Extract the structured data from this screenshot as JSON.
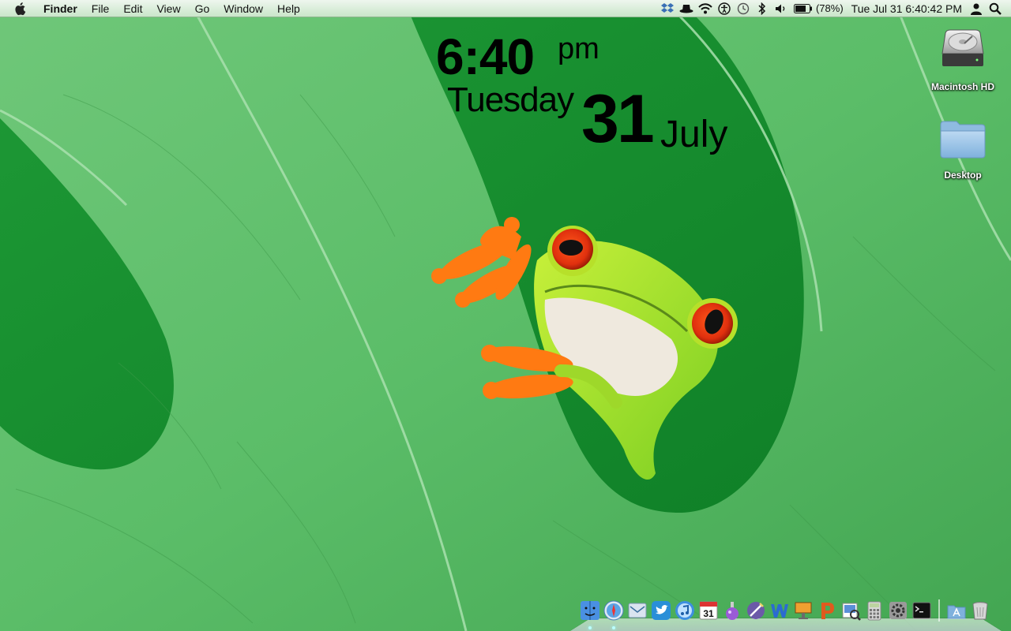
{
  "menubar": {
    "app_name": "Finder",
    "menus": [
      "File",
      "Edit",
      "View",
      "Go",
      "Window",
      "Help"
    ],
    "battery_percent": "(78%)",
    "datetime": "Tue Jul 31  6:40:42 PM",
    "status_icons": [
      "dropbox-icon",
      "hat-icon",
      "wifi-icon",
      "accessibility-icon",
      "time-machine-icon",
      "bluetooth-icon",
      "volume-icon",
      "battery-icon",
      "user-icon",
      "spotlight-icon"
    ]
  },
  "clock": {
    "time": "6:40",
    "ampm": "pm",
    "weekday": "Tuesday",
    "day": "31",
    "month": "July"
  },
  "desktop": {
    "icons": [
      {
        "label": "Macintosh HD",
        "icon": "hard-drive-icon"
      },
      {
        "label": "Desktop",
        "icon": "folder-icon"
      }
    ]
  },
  "dock": {
    "apps": [
      "finder-icon",
      "safari-icon",
      "mail-icon",
      "twitter-icon",
      "itunes-icon",
      "ical-icon",
      "potion-icon",
      "sketch-icon",
      "word-icon",
      "keynote-icon",
      "powerpoint-icon",
      "preview-icon",
      "calculator-icon",
      "system-preferences-icon",
      "terminal-icon"
    ],
    "stacks": [
      "applications-folder-icon",
      "trash-icon"
    ],
    "calendar_day": "31"
  },
  "colors": {
    "menubar_top": "#eef6ee",
    "menubar_bottom": "#c9e6c9",
    "leaf_green": "#55b85e",
    "deep_green": "#0f8a2a",
    "frog_green": "#9be02a",
    "frog_orange": "#ff7a12",
    "frog_eye_red": "#e02a10"
  }
}
